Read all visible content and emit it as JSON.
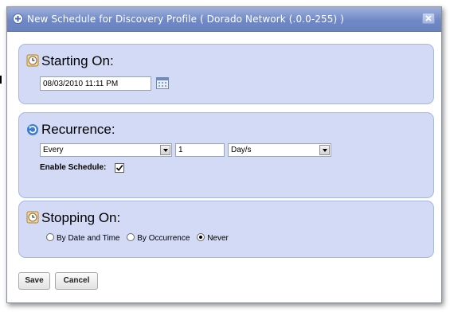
{
  "dialog": {
    "title": "New Schedule for Discovery Profile ( Dorado Network (.0.0-255) )",
    "close_icon": "close-icon"
  },
  "starting_on": {
    "title": "Starting On:",
    "icon": "clock-icon",
    "datetime_value": "08/03/2010 11:11 PM",
    "calendar_icon": "calendar-icon"
  },
  "recurrence": {
    "title": "Recurrence:",
    "icon": "refresh-icon",
    "frequency_selected": "Every",
    "interval_value": "1",
    "unit_selected": "Day/s",
    "enable_label": "Enable Schedule:",
    "enable_checked": true
  },
  "stopping_on": {
    "title": "Stopping On:",
    "icon": "clock-icon",
    "options": [
      {
        "label": "By Date and Time",
        "checked": false
      },
      {
        "label": "By Occurrence",
        "checked": false
      },
      {
        "label": "Never",
        "checked": true
      }
    ]
  },
  "footer": {
    "save_label": "Save",
    "cancel_label": "Cancel"
  },
  "colors": {
    "titlebar": "#7089c6",
    "panel": "#d2daf5",
    "panel_border": "#a9b6de"
  }
}
